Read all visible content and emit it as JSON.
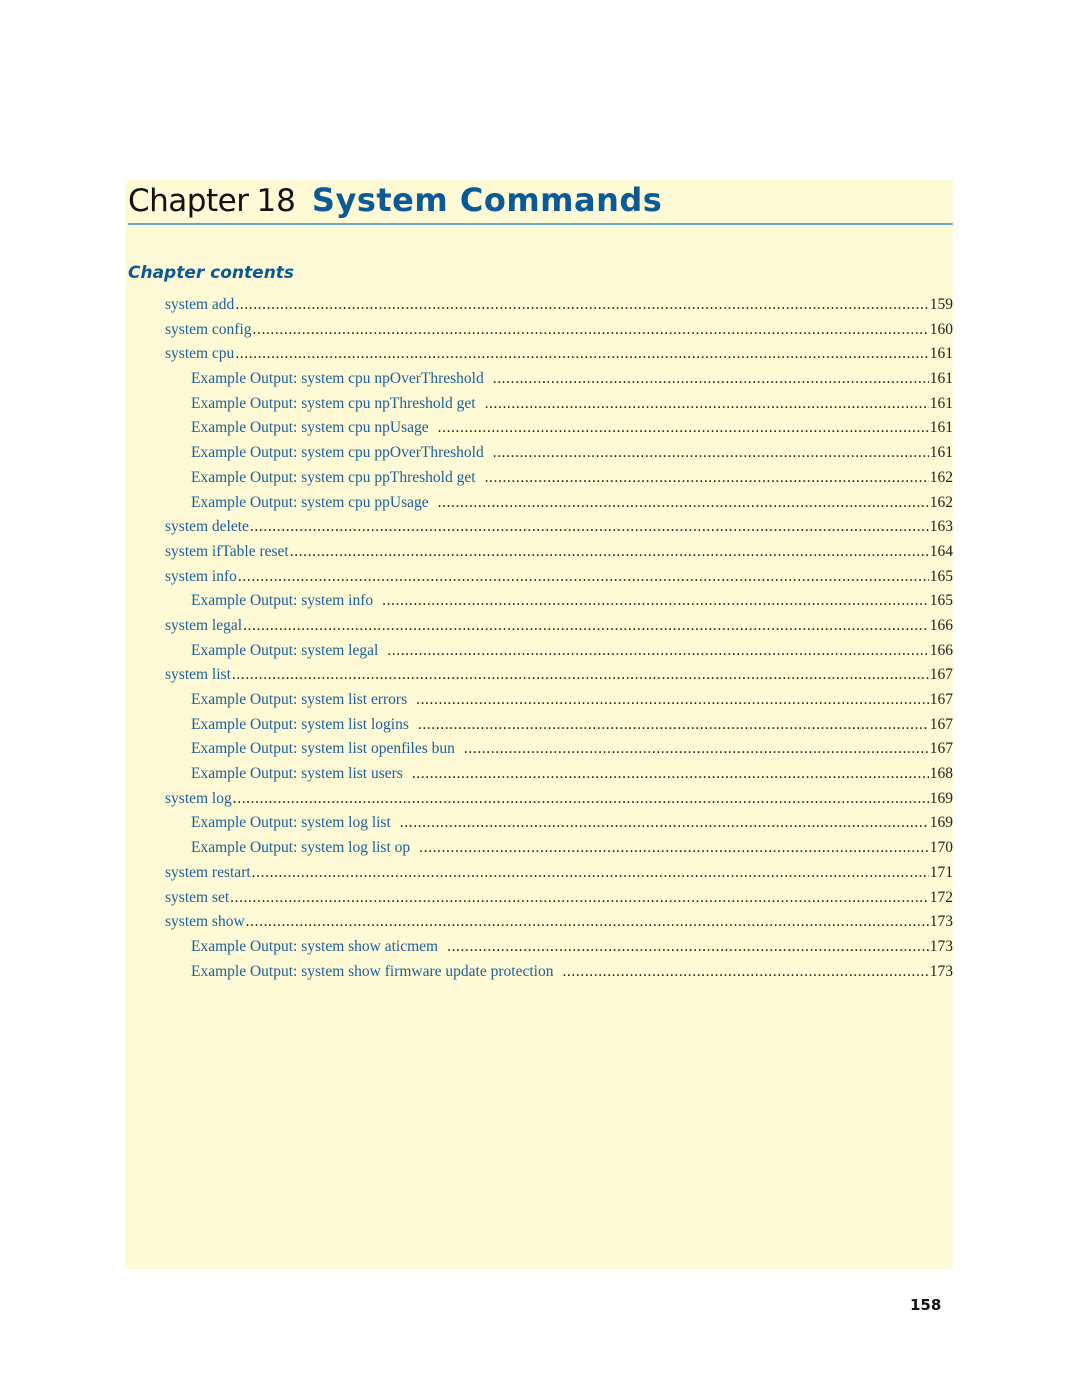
{
  "chapter": {
    "label": "Chapter",
    "number": "18",
    "title": "System Commands"
  },
  "contents_heading": "Chapter contents",
  "toc": [
    {
      "title": "system add",
      "page": "159",
      "level": 1
    },
    {
      "title": "system config",
      "page": "160",
      "level": 1
    },
    {
      "title": "system cpu",
      "page": "161",
      "level": 1
    },
    {
      "title": "Example Output: system cpu npOverThreshold",
      "page": "161",
      "level": 2
    },
    {
      "title": "Example Output: system cpu npThreshold get",
      "page": "161",
      "level": 2
    },
    {
      "title": "Example Output: system cpu npUsage",
      "page": "161",
      "level": 2
    },
    {
      "title": "Example Output: system cpu ppOverThreshold",
      "page": "161",
      "level": 2
    },
    {
      "title": "Example Output: system cpu ppThreshold get",
      "page": "162",
      "level": 2
    },
    {
      "title": "Example Output: system cpu ppUsage",
      "page": "162",
      "level": 2
    },
    {
      "title": "system delete",
      "page": "163",
      "level": 1
    },
    {
      "title": "system ifTable reset",
      "page": "164",
      "level": 1
    },
    {
      "title": "system info",
      "page": "165",
      "level": 1
    },
    {
      "title": "Example Output: system info",
      "page": "165",
      "level": 2
    },
    {
      "title": "system legal",
      "page": "166",
      "level": 1
    },
    {
      "title": "Example Output: system legal",
      "page": "166",
      "level": 2
    },
    {
      "title": "system list",
      "page": "167",
      "level": 1
    },
    {
      "title": "Example Output: system list errors",
      "page": "167",
      "level": 2
    },
    {
      "title": "Example Output: system list logins",
      "page": "167",
      "level": 2
    },
    {
      "title": "Example Output: system list openfiles bun",
      "page": "167",
      "level": 2
    },
    {
      "title": "Example Output: system list users",
      "page": "168",
      "level": 2
    },
    {
      "title": "system log",
      "page": "169",
      "level": 1
    },
    {
      "title": "Example Output: system log list",
      "page": "169",
      "level": 2
    },
    {
      "title": "Example Output: system log list op",
      "page": "170",
      "level": 2
    },
    {
      "title": "system restart",
      "page": "171",
      "level": 1
    },
    {
      "title": "system set",
      "page": "172",
      "level": 1
    },
    {
      "title": "system show",
      "page": "173",
      "level": 1
    },
    {
      "title": "Example Output: system show aticmem",
      "page": "173",
      "level": 2
    },
    {
      "title": "Example Output: system show firmware update protection",
      "page": "173",
      "level": 2
    }
  ],
  "page_number": "158",
  "colors": {
    "accent": "#0b5a96",
    "link": "#1a5f99",
    "panel_background": "#fefad5",
    "rule": "#6fa8c4"
  }
}
